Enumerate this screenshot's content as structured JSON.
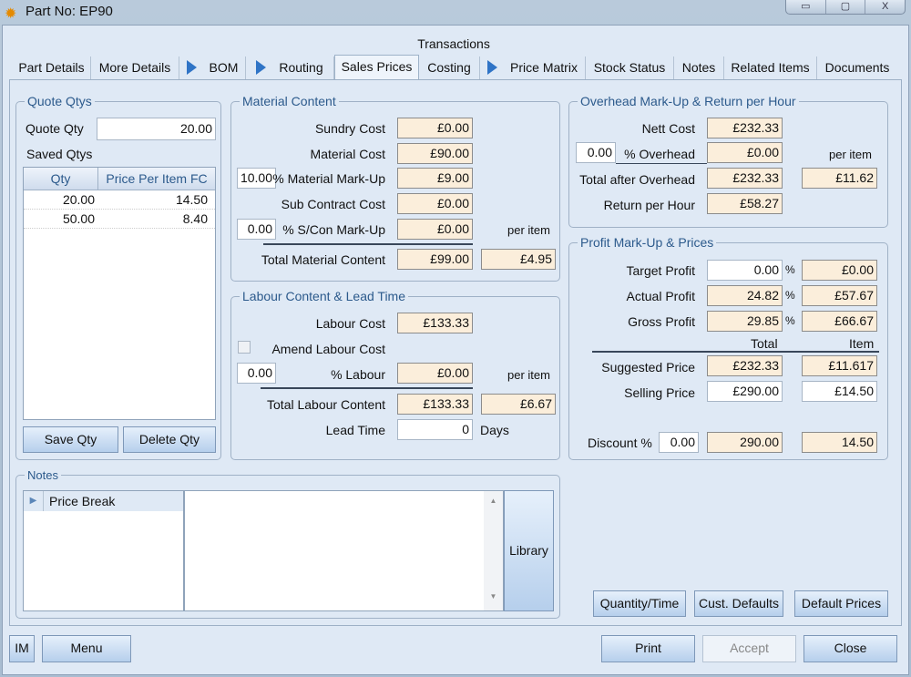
{
  "window": {
    "title": "Part No: EP90",
    "minimize": "▭",
    "maximize": "▢",
    "close": "X"
  },
  "tabs_group_title": "Transactions",
  "tabs": [
    {
      "label": "Part Details"
    },
    {
      "label": "More Details"
    },
    {
      "label": "BOM"
    },
    {
      "label": "Routing"
    },
    {
      "label": "Sales Prices",
      "selected": true
    },
    {
      "label": "Costing"
    },
    {
      "label": "Price Matrix"
    },
    {
      "label": "Stock Status"
    },
    {
      "label": "Notes"
    },
    {
      "label": "Related Items"
    },
    {
      "label": "Documents"
    }
  ],
  "quote": {
    "title": "Quote Qtys",
    "qty_label": "Quote Qty",
    "qty_value": "20.00",
    "saved_label": "Saved Qtys",
    "columns": [
      "Qty",
      "Price Per Item FC"
    ],
    "rows": [
      [
        "20.00",
        "14.50"
      ],
      [
        "50.00",
        "8.40"
      ]
    ],
    "save": "Save Qty",
    "delete": "Delete Qty"
  },
  "material": {
    "title": "Material Content",
    "sundry_label": "Sundry Cost",
    "sundry": "£0.00",
    "material_label": "Material Cost",
    "material": "£90.00",
    "markup_pct": "10.00",
    "markup_label": "% Material Mark-Up",
    "markup": "£9.00",
    "subcon_label": "Sub Contract Cost",
    "subcon": "£0.00",
    "subcon_pct": "0.00",
    "subcon_markup_label": "% S/Con Mark-Up",
    "subcon_markup": "£0.00",
    "per_item": "per item",
    "total_label": "Total Material Content",
    "total": "£99.00",
    "total_item": "£4.95"
  },
  "labour": {
    "title": "Labour Content & Lead Time",
    "cost_label": "Labour Cost",
    "cost": "£133.33",
    "amend_label": "Amend Labour Cost",
    "amend_checked": false,
    "pct": "0.00",
    "pct_label": "% Labour",
    "pct_value": "£0.00",
    "per_item": "per item",
    "total_label": "Total Labour Content",
    "total": "£133.33",
    "total_item": "£6.67",
    "lead_label": "Lead Time",
    "lead": "0",
    "lead_unit": "Days"
  },
  "overhead": {
    "title": "Overhead Mark-Up & Return per Hour",
    "nett_label": "Nett Cost",
    "nett": "£232.33",
    "pct": "0.00",
    "pct_label": "% Overhead",
    "pct_value": "£0.00",
    "per_item": "per item",
    "total_label": "Total after Overhead",
    "total": "£232.33",
    "total_item": "£11.62",
    "rph_label": "Return per Hour",
    "rph": "£58.27"
  },
  "profit": {
    "title": "Profit Mark-Up & Prices",
    "target_label": "Target Profit",
    "target_pct": "0.00",
    "target": "£0.00",
    "actual_label": "Actual Profit",
    "actual_pct": "24.82",
    "actual": "£57.67",
    "gross_label": "Gross Profit",
    "gross_pct": "29.85",
    "gross": "£66.67",
    "pct_sign": "%",
    "total_hdr": "Total",
    "item_hdr": "Item",
    "suggested_label": "Suggested Price",
    "suggested": "£232.33",
    "suggested_item": "£11.617",
    "selling_label": "Selling Price",
    "selling": "£290.00",
    "selling_item": "£14.50",
    "discount_label": "Discount %",
    "discount": "0.00",
    "discount_total": "290.00",
    "discount_item": "14.50"
  },
  "notes": {
    "title": "Notes",
    "items": [
      "Price Break"
    ],
    "library": "Library"
  },
  "actions": {
    "quantity_time": "Quantity/Time",
    "cust_defaults": "Cust. Defaults",
    "default_prices": "Default Prices"
  },
  "footer": {
    "im": "IM",
    "menu": "Menu",
    "print": "Print",
    "accept": "Accept",
    "close": "Close"
  }
}
